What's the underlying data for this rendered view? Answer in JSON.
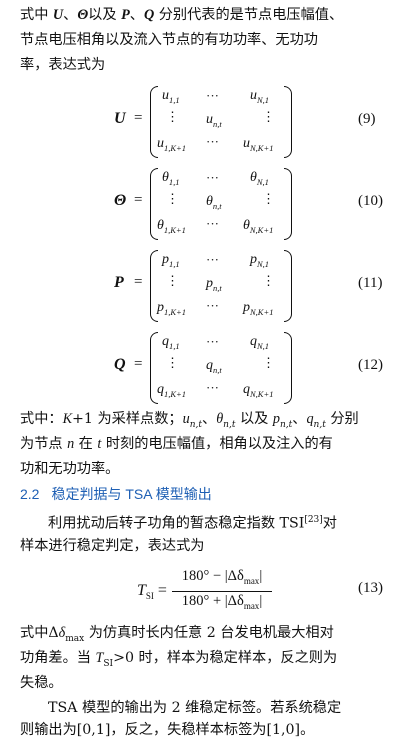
{
  "para1": {
    "line1": {
      "a": "式中 ",
      "U": "U",
      "sep1": "、",
      "Theta": "Θ",
      "b": "以及 ",
      "P": "P",
      "sep2": "、",
      "Q": "Q",
      "c": " 分别代表的是节点电压幅值、"
    },
    "line2": "节点电压相角以及流入节点的有功功率、无功功",
    "line3": "率，表达式为"
  },
  "equations": [
    {
      "lhs": "U",
      "eq": "=",
      "number": "(9)",
      "sym": "u"
    },
    {
      "lhs": "Θ",
      "eq": "=",
      "number": "(10)",
      "sym": "θ"
    },
    {
      "lhs": "P",
      "eq": "=",
      "number": "(11)",
      "sym": "p"
    },
    {
      "lhs": "Q",
      "eq": "=",
      "number": "(12)",
      "sym": "q"
    }
  ],
  "matrix_subs": {
    "s11": "1,1",
    "sN1": "N,1",
    "snt": "n,t",
    "s1K": "1,K+1",
    "sNK": "N,K+1",
    "hdots": "···",
    "vdots": "⋮"
  },
  "para2": {
    "line1": {
      "a": "式中：",
      "K": "K",
      "b": "+1 为采样点数；",
      "u": "u",
      "ut": "n,t",
      "s1": "、",
      "th": "θ",
      "tht": "n,t",
      "c": " 以及 ",
      "p": "p",
      "pt": "n,t",
      "s2": "、",
      "q": "q",
      "qt": "n,t",
      "d": " 分别"
    },
    "line2": {
      "a": "为节点 ",
      "n": "n",
      "b": " 在 ",
      "t": "t",
      "c": " 时刻的电压幅值，相角以及注入的有"
    },
    "line3": "功和无功功率。"
  },
  "section": {
    "number": "2.2",
    "title": "稳定判据与 TSA 模型输出"
  },
  "para3": {
    "line1": {
      "a": "利用扰动后转子功角的暂态稳定指数 TSI",
      "ref": "[23]",
      "b": "对"
    },
    "line2": "样本进行稳定判定，表达式为"
  },
  "tsi_eq": {
    "T": "T",
    "sub": "SI",
    "eq": " =",
    "numerator": "180° − |Δδ",
    "denominator": "180° + |Δδ",
    "max": "max",
    "bar_end": "|",
    "number": "(13)"
  },
  "para4": {
    "line1": {
      "a": "式中Δ",
      "d": "δ",
      "max": "max",
      "b": " 为仿真时长内任意 2 台发电机最大相对"
    },
    "line2": {
      "a": "功角差。当 ",
      "T": "T",
      "sub": "SI",
      "b": ">0 时，样本为稳定样本，反之则为"
    },
    "line3": "失稳。"
  },
  "para5": {
    "line1": "TSA 模型的输出为 2 维稳定标签。若系统稳定",
    "line2": "则输出为[0,1]，反之，失稳样本标签为[1,0]。"
  }
}
